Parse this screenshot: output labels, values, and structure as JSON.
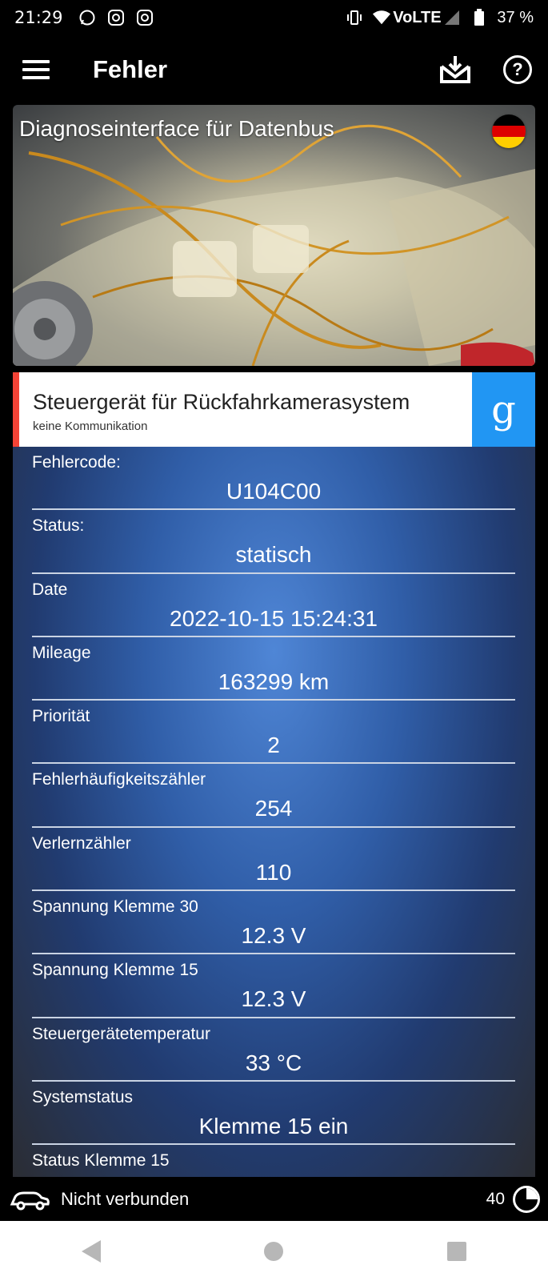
{
  "status_bar": {
    "time": "21:29",
    "battery": "37 %",
    "app_icons": [
      "whatsapp-icon",
      "instagram-icon",
      "instagram-icon"
    ]
  },
  "app_bar": {
    "title": "Fehler"
  },
  "banner": {
    "title": "Diagnoseinterface für Datenbus"
  },
  "module": {
    "name": "Steuergerät für Rückfahrkamerasystem",
    "status": "keine Kommunikation",
    "search_label": "g",
    "accent_color": "#f44336",
    "search_color": "#2196f3"
  },
  "details": [
    {
      "label": "Fehlercode:",
      "value": "U104C00"
    },
    {
      "label": "Status:",
      "value": "statisch"
    },
    {
      "label": "Date",
      "value": "2022-10-15 15:24:31"
    },
    {
      "label": "Mileage",
      "value": "163299 km"
    },
    {
      "label": "Priorität",
      "value": "2"
    },
    {
      "label": "Fehlerhäufigkeitszähler",
      "value": "254"
    },
    {
      "label": "Verlernzähler",
      "value": "110"
    },
    {
      "label": "Spannung Klemme 30",
      "value": "12.3 V"
    },
    {
      "label": "Spannung Klemme 15",
      "value": "12.3 V"
    },
    {
      "label": "Steuergerätetemperatur",
      "value": "33 °C"
    },
    {
      "label": "Systemstatus",
      "value": "Klemme 15 ein"
    },
    {
      "label": "Status Klemme 15",
      "value": ""
    }
  ],
  "bottom_bar": {
    "connection": "Nicht verbunden",
    "count": "40"
  }
}
